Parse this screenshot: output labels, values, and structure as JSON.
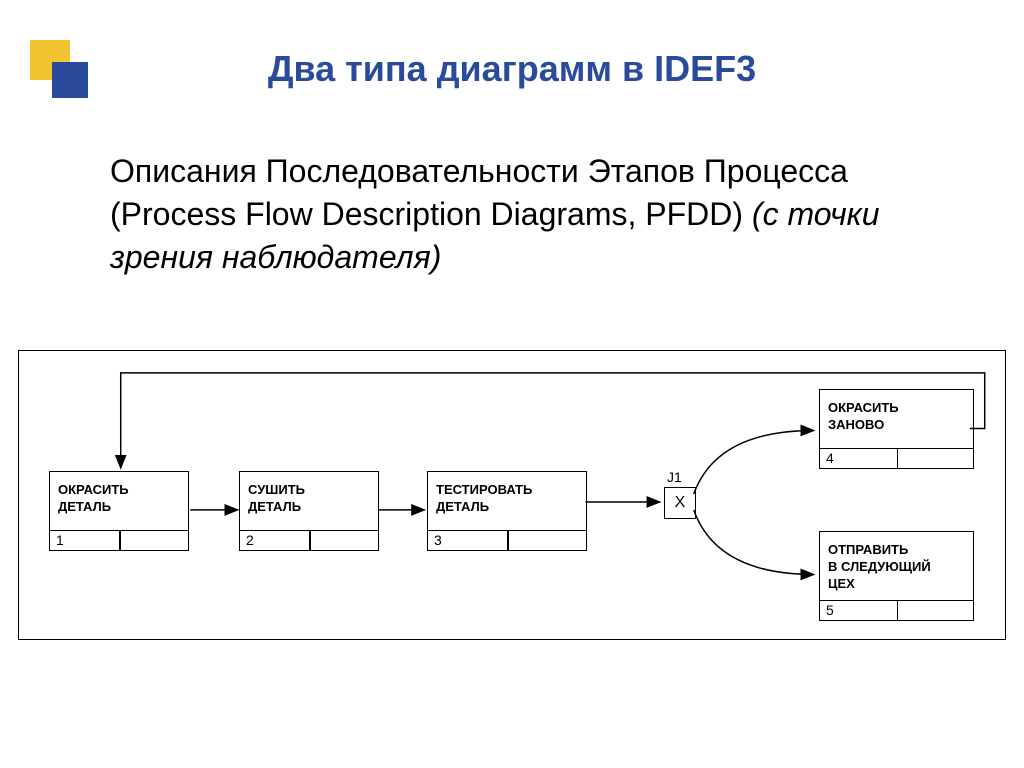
{
  "title": "Два типа диаграмм в IDEF3",
  "paragraph": {
    "main": "Описания Последовательности Этапов Процесса (Process Flow Description Diagrams, PFDD) ",
    "italic": "(с точки зрения наблюдателя)"
  },
  "diagram": {
    "boxes": {
      "b1": {
        "label": "ОКРАСИТЬ\nДЕТАЛЬ",
        "id": "1"
      },
      "b2": {
        "label": "СУШИТЬ\nДЕТАЛЬ",
        "id": "2"
      },
      "b3": {
        "label": "ТЕСТИРОВАТЬ\nДЕТАЛЬ",
        "id": "3"
      },
      "b4": {
        "label": "ОКРАСИТЬ\nЗАНОВО",
        "id": "4"
      },
      "b5": {
        "label": "ОТПРАВИТЬ\nВ СЛЕДУЮЩИЙ\nЦЕХ",
        "id": "5"
      }
    },
    "junction": {
      "label": "J1",
      "symbol": "X"
    }
  }
}
